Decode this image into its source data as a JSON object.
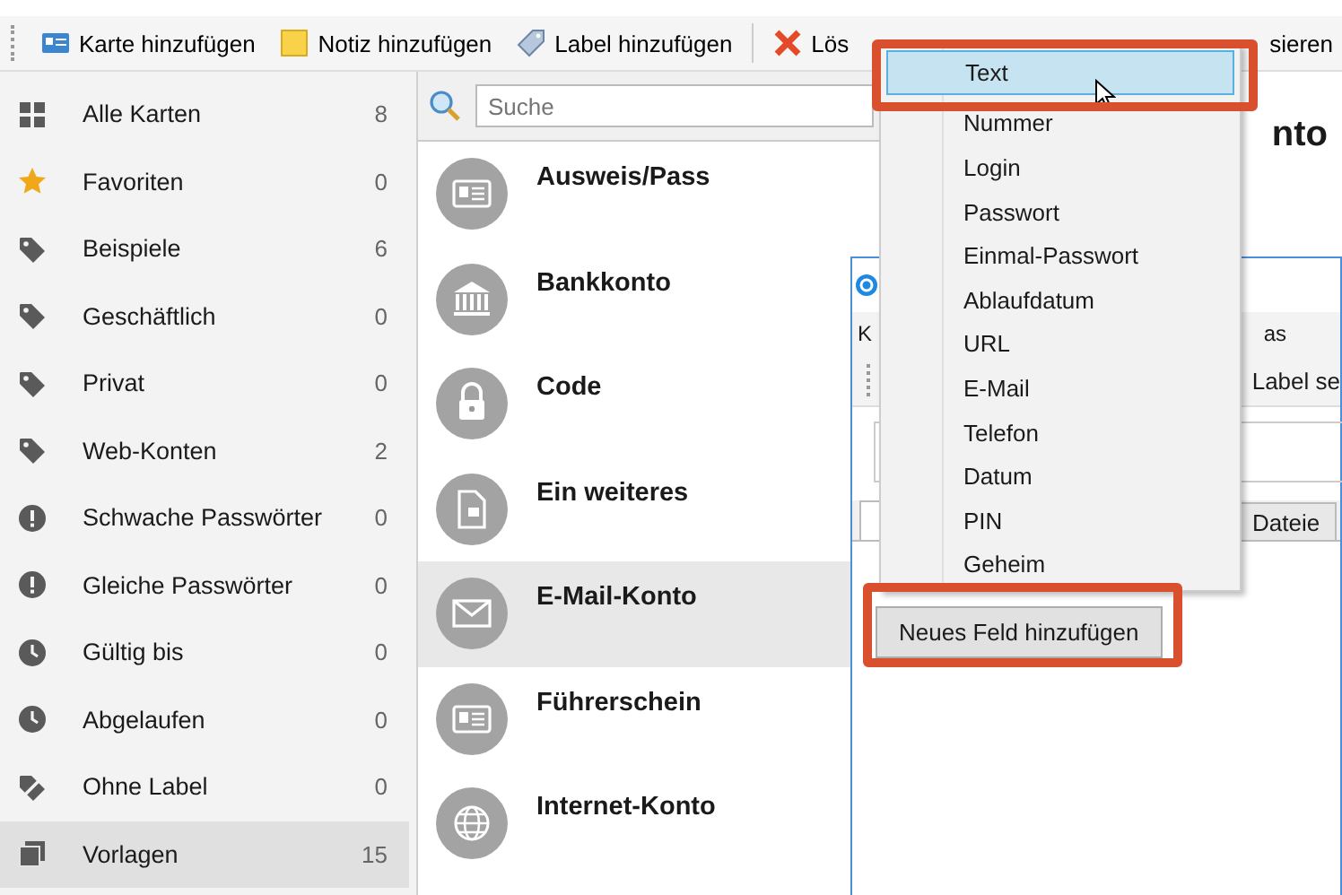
{
  "toolbar": [
    {
      "kind": "card",
      "label": "Karte hinzufügen"
    },
    {
      "kind": "note",
      "label": "Notiz hinzufügen"
    },
    {
      "kind": "label",
      "label": "Label hinzufügen"
    },
    {
      "kind": "delete",
      "label": "Lös"
    },
    {
      "kind": "plain",
      "label": "sieren"
    }
  ],
  "sidebar": {
    "items": [
      {
        "kind": "all",
        "label": "Alle Karten",
        "count": "8",
        "selected": false
      },
      {
        "kind": "favorite",
        "label": "Favoriten",
        "count": "0",
        "selected": false
      },
      {
        "kind": "label",
        "label": "Beispiele",
        "count": "6",
        "selected": false
      },
      {
        "kind": "label",
        "label": "Geschäftlich",
        "count": "0",
        "selected": false
      },
      {
        "kind": "label",
        "label": "Privat",
        "count": "0",
        "selected": false
      },
      {
        "kind": "label",
        "label": "Web-Konten",
        "count": "2",
        "selected": false
      },
      {
        "kind": "alert",
        "label": "Schwache Passwörter",
        "count": "0",
        "selected": false
      },
      {
        "kind": "alert",
        "label": "Gleiche Passwörter",
        "count": "0",
        "selected": false
      },
      {
        "kind": "clock",
        "label": "Gültig bis",
        "count": "0",
        "selected": false
      },
      {
        "kind": "clock",
        "label": "Abgelaufen",
        "count": "0",
        "selected": false
      },
      {
        "kind": "unlabeled",
        "label": "Ohne Label",
        "count": "0",
        "selected": false
      },
      {
        "kind": "templates",
        "label": "Vorlagen",
        "count": "15",
        "selected": true
      }
    ]
  },
  "search": {
    "placeholder": "Suche"
  },
  "card_list": [
    {
      "kind": "id",
      "title": "Ausweis/Pass",
      "selected": false
    },
    {
      "kind": "bank",
      "title": "Bankkonto",
      "selected": false
    },
    {
      "kind": "lock",
      "title": "Code",
      "selected": false
    },
    {
      "kind": "doc",
      "title": "Ein weiteres",
      "selected": false
    },
    {
      "kind": "mail",
      "title": "E-Mail-Konto",
      "selected": true
    },
    {
      "kind": "id",
      "title": "Führerschein",
      "selected": false
    },
    {
      "kind": "globe",
      "title": "Internet-Konto",
      "selected": false
    }
  ],
  "detail": {
    "title": "nto"
  },
  "dialog": {
    "menu": [
      "K",
      "as"
    ],
    "toolbar_label": "Label se",
    "tabs": [
      {
        "selected": true
      },
      {
        "label": "Dateie",
        "selected": false
      }
    ],
    "add_field_button": "Neues Feld hinzufügen"
  },
  "field_type_menu": {
    "items": [
      {
        "label": "Text",
        "selected": true
      },
      {
        "label": "Nummer",
        "selected": false
      },
      {
        "label": "Login",
        "selected": false
      },
      {
        "label": "Passwort",
        "selected": false
      },
      {
        "label": "Einmal-Passwort",
        "selected": false
      },
      {
        "label": "Ablaufdatum",
        "selected": false
      },
      {
        "label": "URL",
        "selected": false
      },
      {
        "label": "E-Mail",
        "selected": false
      },
      {
        "label": "Telefon",
        "selected": false
      },
      {
        "label": "Datum",
        "selected": false
      },
      {
        "label": "PIN",
        "selected": false
      },
      {
        "label": "Geheim",
        "selected": false
      }
    ]
  }
}
